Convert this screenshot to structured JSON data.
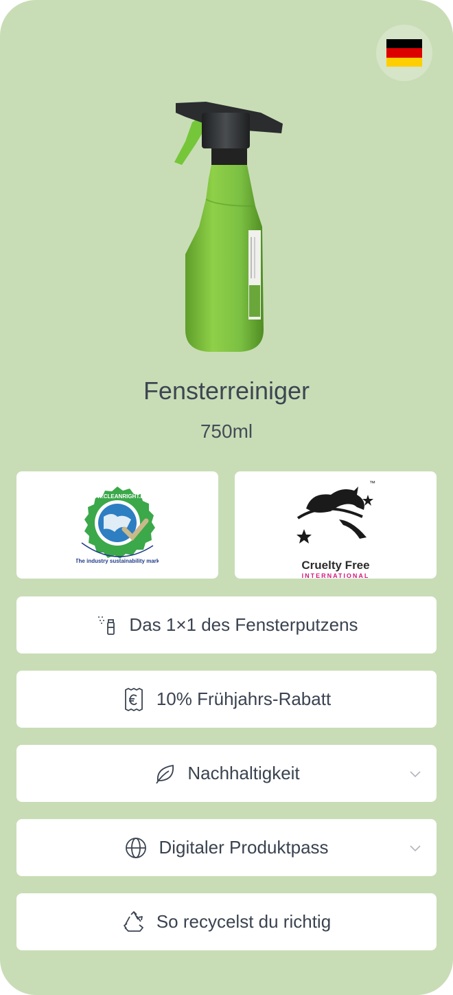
{
  "language": {
    "flag": "german-flag",
    "colors": [
      "#000000",
      "#dd0000",
      "#ffce00"
    ]
  },
  "product": {
    "name": "Fensterreiniger",
    "size": "750ml",
    "bottle_label": "Drane"
  },
  "certifications": [
    {
      "name": "cleanright",
      "text_top": "WWW.CLEANRIGHT.EU",
      "text_bottom": "The industry sustainability mark"
    },
    {
      "name": "cruelty-free",
      "line1": "Cruelty Free",
      "line2": "INTERNATIONAL",
      "tm": "™"
    }
  ],
  "buttons": [
    {
      "label": "Das 1×1 des Fensterputzens",
      "icon": "spray-icon"
    },
    {
      "label": "10% Frühjahrs-Rabatt",
      "icon": "euro-receipt-icon"
    },
    {
      "label": "Nachhaltigkeit",
      "icon": "leaf-icon",
      "expandable": true
    },
    {
      "label": "Digitaler Produktpass",
      "icon": "globe-icon",
      "expandable": true
    },
    {
      "label": "So recycelst du richtig",
      "icon": "recycle-icon"
    }
  ],
  "colors": {
    "background": "#c8ddb6",
    "card": "#ffffff",
    "text": "#3a4350",
    "bottle": "#7cc043"
  }
}
